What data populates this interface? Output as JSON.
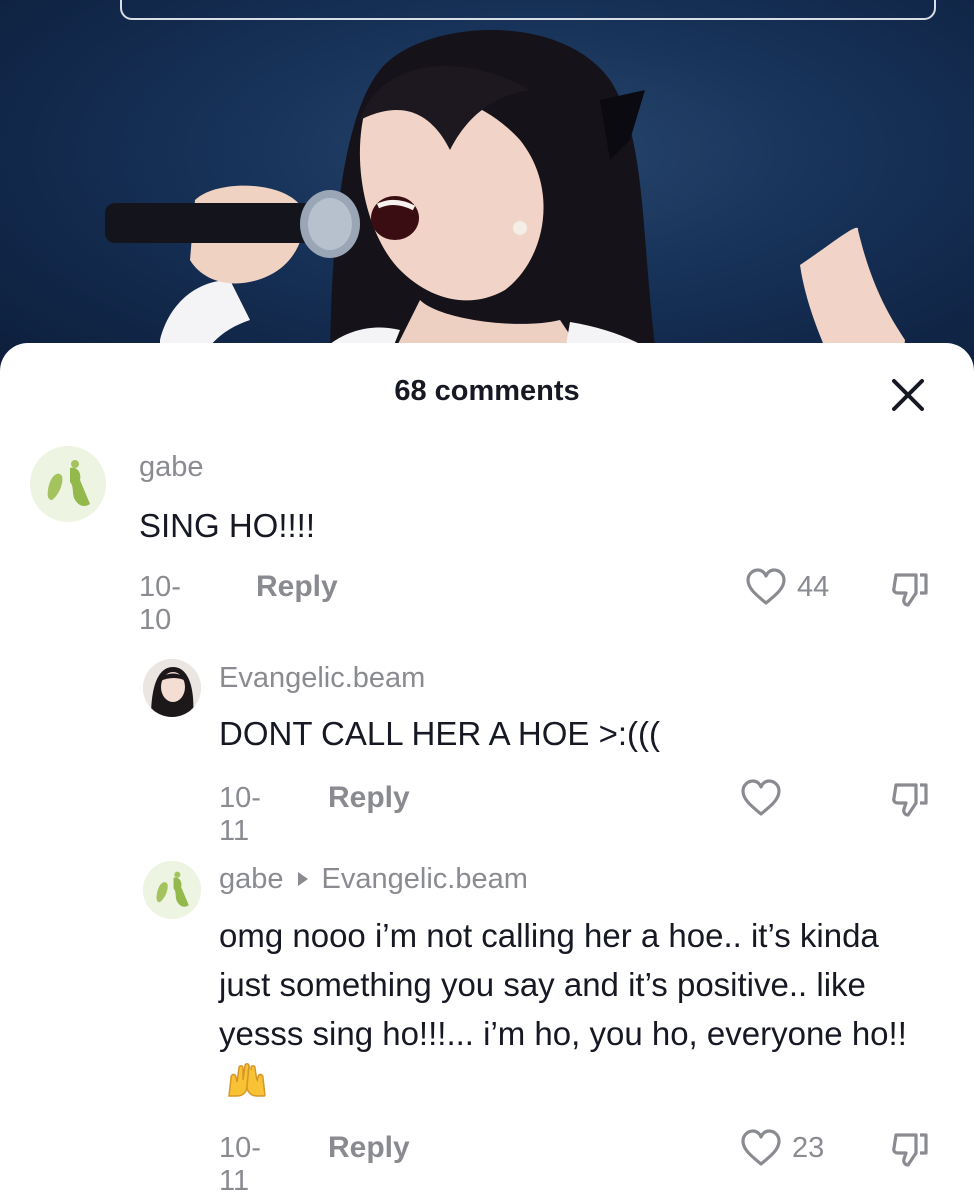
{
  "comments_sheet": {
    "title": "68 comments",
    "close_icon": "close-icon"
  },
  "comments": [
    {
      "username": "gabe",
      "text": "SING HO!!!!",
      "date": "10-10",
      "reply_label": "Reply",
      "likes": "44"
    },
    {
      "username": "Evangelic.beam",
      "text": "DONT CALL HER A HOE >:(((",
      "date": "10-11",
      "reply_label": "Reply",
      "likes": ""
    },
    {
      "username": "gabe",
      "reply_to": "Evangelic.beam",
      "text": "omg nooo i’m not calling her a hoe.. it’s kinda just something you say and it’s positive.. like yesss sing ho!!!... i’m ho, you ho, everyone ho!!",
      "emoji": "raising-hands-emoji",
      "date": "10-11",
      "reply_label": "Reply",
      "likes": "23"
    }
  ],
  "colors": {
    "text_primary": "#161823",
    "text_secondary": "#8a8b91",
    "background": "#ffffff"
  },
  "icons": [
    "heart-icon",
    "dislike-icon",
    "close-icon",
    "reply-arrow-icon"
  ]
}
